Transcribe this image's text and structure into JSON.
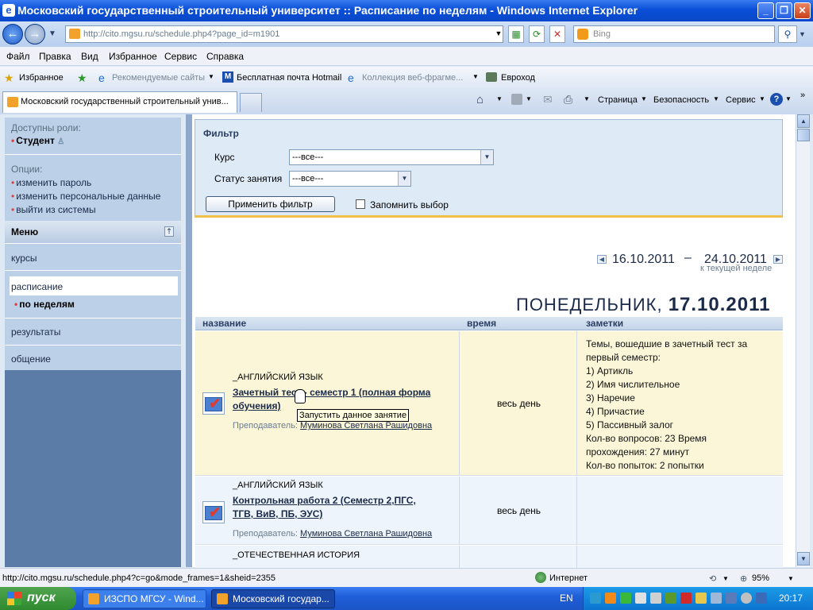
{
  "window": {
    "title": "Московский государственный строительный университет :: Расписание по неделям - Windows Internet Explorer"
  },
  "address": {
    "url": "http://cito.mgsu.ru/schedule.php4?page_id=m1901",
    "search_placeholder": "Bing"
  },
  "menubar": {
    "items": [
      "Файл",
      "Правка",
      "Вид",
      "Избранное",
      "Сервис",
      "Справка"
    ]
  },
  "favorites": {
    "label": "Избранное",
    "items": [
      "Рекомендуемые сайты",
      "Бесплатная почта Hotmail",
      "Коллекция веб-фрагме...",
      "Евроход"
    ]
  },
  "tabs": {
    "active": "Московский государственный строительный унив..."
  },
  "commandbar": {
    "page": "Страница",
    "safety": "Безопасность",
    "service": "Сервис"
  },
  "sidebar": {
    "roles_label": "Доступны роли:",
    "role": "Студент",
    "options_label": "Опции:",
    "options": [
      "изменить пароль",
      "изменить персональные данные",
      "выйти из системы"
    ],
    "menu_title": "Меню",
    "courses": "курсы",
    "schedule": "расписание",
    "schedule_sub": "по неделям",
    "results": "результаты",
    "communication": "общение"
  },
  "filter": {
    "title": "Фильтр",
    "course_label": "Курс",
    "course_value": "---все---",
    "status_label": "Статус занятия",
    "status_value": "---все---",
    "apply": "Применить фильтр",
    "remember": "Запомнить выбор"
  },
  "week": {
    "start": "16.10.2011",
    "dash": "–",
    "end": "24.10.2011",
    "current_link": "к текущей неделе"
  },
  "day": {
    "name": "ПОНЕДЕЛЬНИК,",
    "date": "17.10.2011"
  },
  "table": {
    "headers": [
      "название",
      "время",
      "заметки"
    ],
    "rows": [
      {
        "course": "_АНГЛИЙСКИЙ ЯЗЫК",
        "title_line1": "Зачетный тест - семестр 1 (полная форма",
        "title_line2": "обучения)",
        "teacher_label": "Преподаватель:",
        "teacher": "Муминова Светлана Рашидовна",
        "time": "весь день",
        "notes": [
          "Темы, вошедшие в зачетный тест за",
          "первый семестр:",
          "1) Артикль",
          "2) Имя числительное",
          "3) Наречие",
          "4) Причастие",
          "5) Пассивный залог",
          "Кол-во вопросов: 23 Время",
          "прохождения: 27 минут",
          "Кол-во попыток: 2 попытки"
        ]
      },
      {
        "course": "_АНГЛИЙСКИЙ ЯЗЫК",
        "title_line1": "Контрольная работа 2 (Семестр 2,ПГС,",
        "title_line2": "ТГВ, ВиВ, ПБ, ЭУС)",
        "teacher_label": "Преподаватель:",
        "teacher": "Муминова Светлана Рашидовна",
        "time": "весь день"
      },
      {
        "course": "_ОТЕЧЕСТВЕННАЯ ИСТОРИЯ"
      }
    ],
    "tooltip": "Запустить данное занятие"
  },
  "statusbar": {
    "url": "http://cito.mgsu.ru/schedule.php4?c=go&mode_frames=1&sheid=2355",
    "zone": "Интернет",
    "zoom": "95%"
  },
  "taskbar": {
    "start": "пуск",
    "tasks": [
      "ИЗСПО МГСУ - Wind...",
      "Московский государ..."
    ],
    "lang": "EN",
    "clock": "20:17"
  }
}
